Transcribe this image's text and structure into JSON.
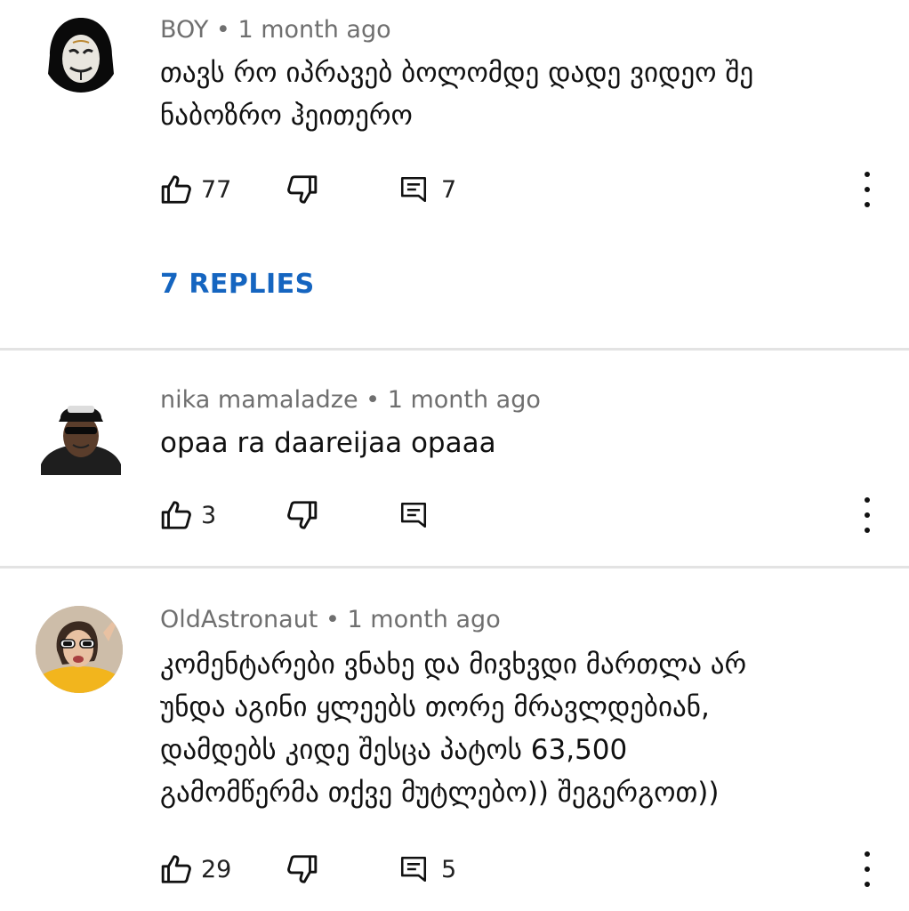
{
  "comments": [
    {
      "author": "BOY",
      "separator": "•",
      "time": "1 month ago",
      "lines": [
        "თავს რო იპრავებ ბოლომდე დადე ვიდეო შე",
        "ნაბოზრო ჰეითერო"
      ],
      "likes": "77",
      "replies_count": "7",
      "replies_link": "7 REPLIES"
    },
    {
      "author": "nika mamaladze",
      "separator": "•",
      "time": "1 month ago",
      "lines": [
        "opaa ra daareijaa opaaa"
      ],
      "likes": "3",
      "replies_count": ""
    },
    {
      "author": "OldAstronaut",
      "separator": "•",
      "time": "1 month ago",
      "lines": [
        "კომენტარები ვნახე და მივხვდი მართლა არ",
        "უნდა აგინი ყლეებს თორე მრავლდებიან,",
        "დამდებს კიდე შესცა პატოს 63,500",
        "გამომწერმა თქვე მუტლებო)) შეგერგოთ))"
      ],
      "likes": "29",
      "replies_count": "5"
    }
  ],
  "colors": {
    "link": "#1565c0",
    "meta": "#6f6f6f",
    "divider": "#e3e3e3"
  },
  "icons": {
    "like": "thumbs-up-icon",
    "dislike": "thumbs-down-icon",
    "reply": "comment-icon",
    "more": "more-vert-icon"
  }
}
